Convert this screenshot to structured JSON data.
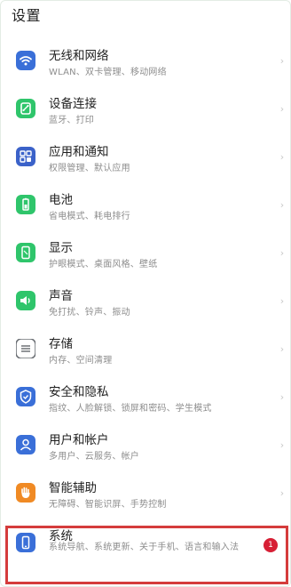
{
  "header": {
    "title": "设置"
  },
  "items": [
    {
      "key": "wifi",
      "label": "无线和网络",
      "sub": "WLAN、双卡管理、移动网络",
      "icon": "wifi-icon",
      "color": "#3a6fd8"
    },
    {
      "key": "device",
      "label": "设备连接",
      "sub": "蓝牙、打印",
      "icon": "device-link-icon",
      "color": "#2fc56b"
    },
    {
      "key": "apps",
      "label": "应用和通知",
      "sub": "权限管理、默认应用",
      "icon": "apps-grid-icon",
      "color": "#3b62c9"
    },
    {
      "key": "battery",
      "label": "电池",
      "sub": "省电模式、耗电排行",
      "icon": "battery-icon",
      "color": "#2fc56b"
    },
    {
      "key": "display",
      "label": "显示",
      "sub": "护眼模式、桌面风格、壁纸",
      "icon": "display-icon",
      "color": "#2fc56b"
    },
    {
      "key": "sound",
      "label": "声音",
      "sub": "免打扰、铃声、振动",
      "icon": "speaker-icon",
      "color": "#2fc56b"
    },
    {
      "key": "storage",
      "label": "存储",
      "sub": "内存、空间清理",
      "icon": "storage-icon",
      "color": "#6e7277"
    },
    {
      "key": "security",
      "label": "安全和隐私",
      "sub": "指纹、人脸解锁、锁屏和密码、学生模式",
      "icon": "shield-icon",
      "color": "#3a6fd8"
    },
    {
      "key": "users",
      "label": "用户和帐户",
      "sub": "多用户、云服务、帐户",
      "icon": "user-icon",
      "color": "#3a6fd8"
    },
    {
      "key": "assist",
      "label": "智能辅助",
      "sub": "无障碍、智能识屏、手势控制",
      "icon": "hand-icon",
      "color": "#f08a24"
    },
    {
      "key": "system",
      "label": "系统",
      "sub": "系统导航、系统更新、关于手机、语言和输入法",
      "icon": "phone-system-icon",
      "color": "#3a6fd8",
      "badge": "1"
    }
  ],
  "colors": {
    "highlight": "#d53c3c",
    "badge": "#d71f35"
  }
}
